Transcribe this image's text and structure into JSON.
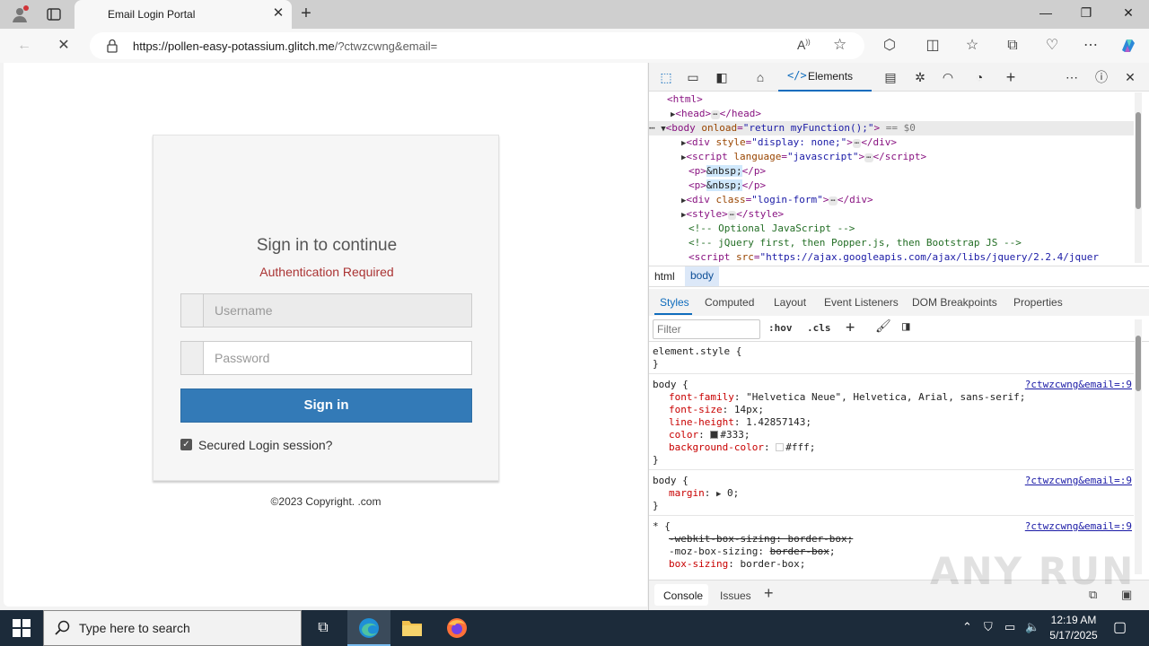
{
  "browser": {
    "tab_title": "Email Login Portal",
    "url_host": "https://pollen-easy-potassium.glitch.me",
    "url_path": "/?ctwzcwng&email="
  },
  "login": {
    "title": "Sign in to continue",
    "subtitle": "Authentication Required",
    "username_placeholder": "Username",
    "password_placeholder": "Password",
    "signin_label": "Sign in",
    "remember_label": "Secured Login session?",
    "remember_checked": true,
    "copyright": "©2023 Copyright. .com"
  },
  "devtools": {
    "elements_tab": "Elements",
    "dom_lines": [
      "<html>",
      "<head>",
      "</head>",
      "<body onload=\"return myFunction();\">",
      "== $0",
      "<div style=\"display: none;\">",
      "<script language=\"javascript\">",
      "<p>&nbsp;</p>",
      "<div class=\"login-form\">",
      "<style>",
      "<!-- Optional JavaScript -->",
      "<!-- jQuery first, then Popper.js, then Bootstrap JS -->",
      "<script src=\"https://ajax.googleapis.com/ajax/libs/jquery/2.2.4/jquer"
    ],
    "breadcrumbs": [
      "html",
      "body"
    ],
    "style_tabs": [
      "Styles",
      "Computed",
      "Layout",
      "Event Listeners",
      "DOM Breakpoints",
      "Properties"
    ],
    "filter_placeholder": "Filter",
    "hov_label": ":hov",
    "cls_label": ".cls",
    "source_link": "?ctwzcwng&email=:9",
    "rules": {
      "element_style": "element.style {",
      "body_font_family": "\"Helvetica Neue\", Helvetica, Arial, sans-serif;",
      "body_font_size": "14px;",
      "body_line_height": "1.42857143;",
      "body_color": "#333;",
      "body_bg": "#fff;",
      "margin_val": "0;",
      "webkit_box": "-webkit-box-sizing: border-box;",
      "moz_box_prop": "-moz-box-sizing:",
      "moz_box_val": "border-box",
      "box_sizing_val": "border-box;"
    },
    "drawer_tabs": [
      "Console",
      "Issues"
    ]
  },
  "taskbar": {
    "search_placeholder": "Type here to search",
    "time": "12:19 AM",
    "date": "5/17/2025"
  },
  "watermark": "ANY RUN"
}
